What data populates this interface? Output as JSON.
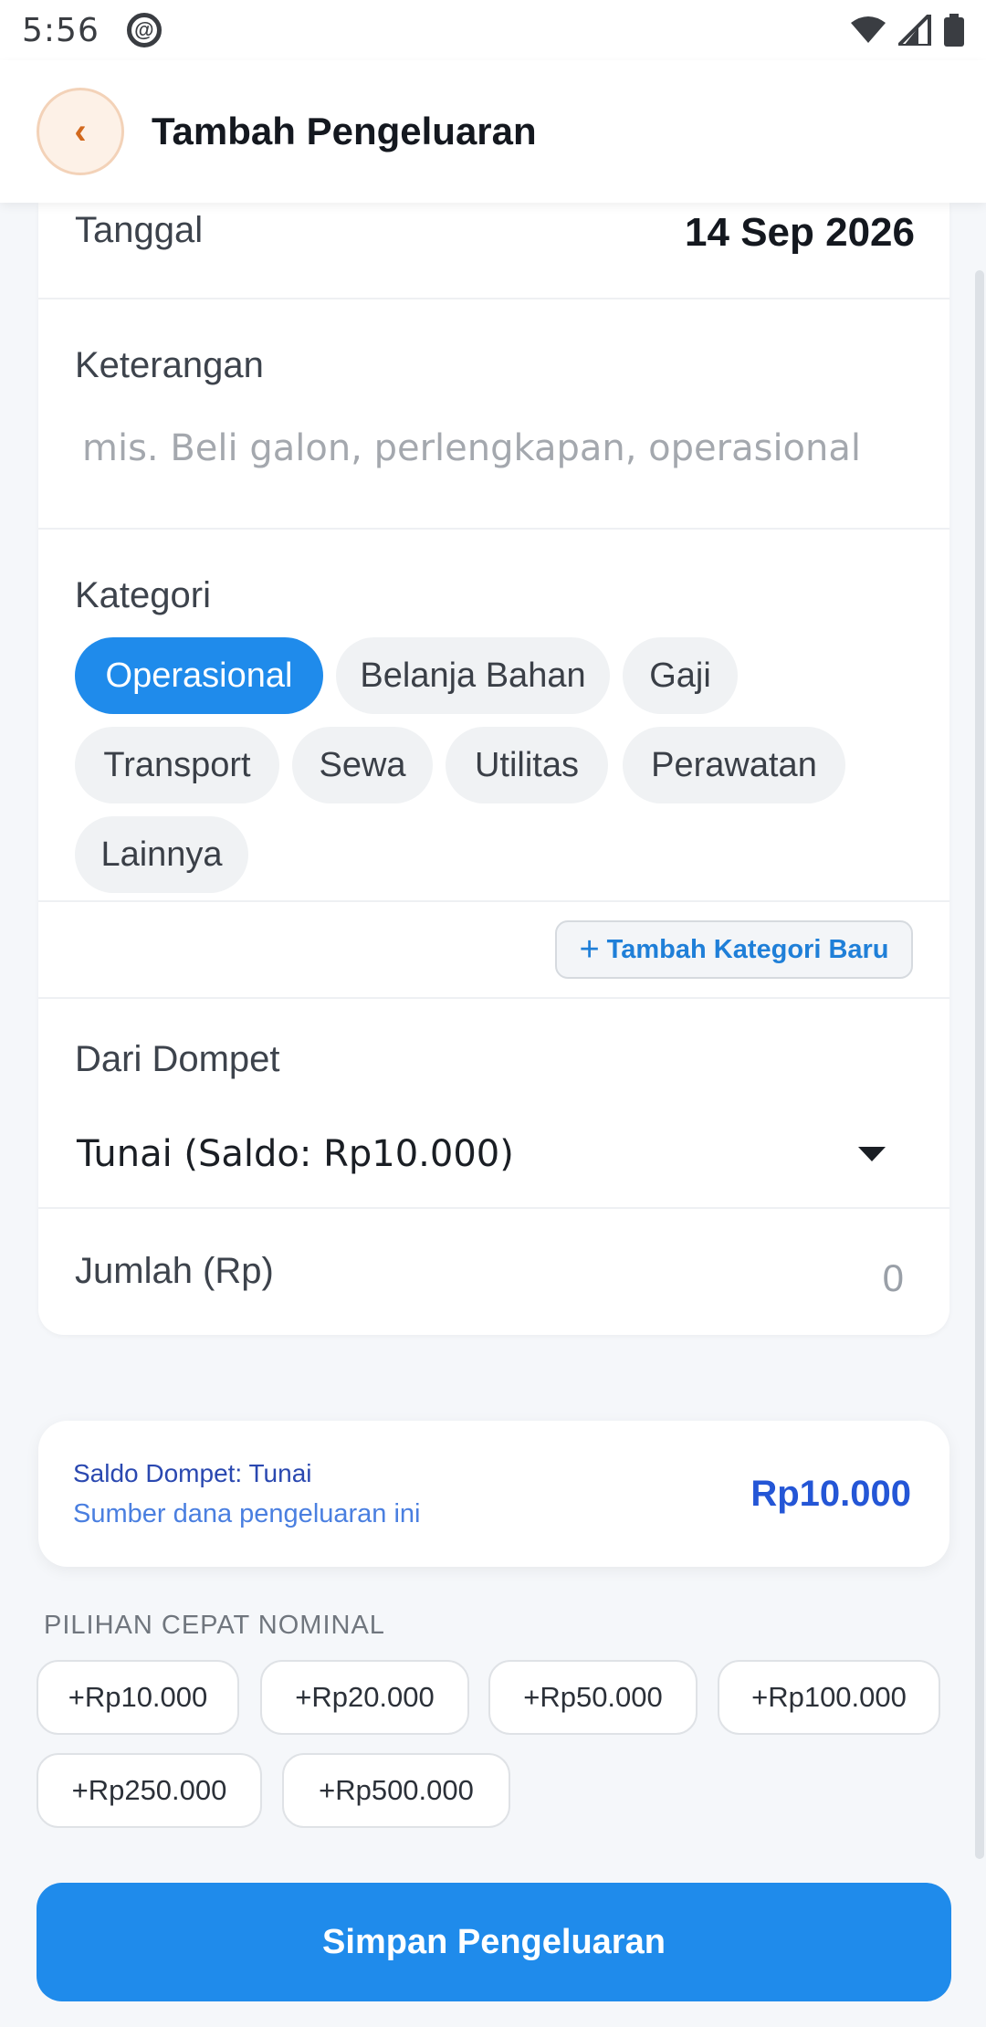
{
  "status_bar": {
    "time": "5:56",
    "icons": [
      "at-sign-icon",
      "wifi-icon",
      "signal-icon",
      "battery-icon"
    ]
  },
  "header": {
    "back_icon": "‹",
    "title": "Tambah Pengeluaran"
  },
  "form": {
    "tanggal": {
      "label": "Tanggal",
      "value": "14 Sep 2026"
    },
    "keterangan": {
      "label": "Keterangan",
      "placeholder": "mis. Beli galon, perlengkapan, operasional",
      "value": ""
    },
    "kategori": {
      "label": "Kategori",
      "selected": "Operasional",
      "options": [
        "Operasional",
        "Belanja Bahan",
        "Gaji",
        "Transport",
        "Sewa",
        "Utilitas",
        "Perawatan",
        "Lainnya"
      ],
      "add_button": "Tambah Kategori Baru"
    },
    "dompet": {
      "label": "Dari Dompet",
      "value": "Tunai (Saldo: Rp10.000)"
    },
    "jumlah": {
      "label": "Jumlah (Rp)",
      "value": "0"
    }
  },
  "saldo_card": {
    "title": "Saldo Dompet: Tunai",
    "subtitle": "Sumber dana pengeluaran ini",
    "amount": "Rp10.000"
  },
  "quick_amounts": {
    "title": "PILIHAN CEPAT NOMINAL",
    "options": [
      "+Rp10.000",
      "+Rp20.000",
      "+Rp50.000",
      "+Rp100.000",
      "+Rp250.000",
      "+Rp500.000"
    ]
  },
  "save_button": "Simpan Pengeluaran",
  "colors": {
    "primary": "#1f8beb",
    "saldo_amount": "#2456d6",
    "back_button": "#d2691e"
  }
}
